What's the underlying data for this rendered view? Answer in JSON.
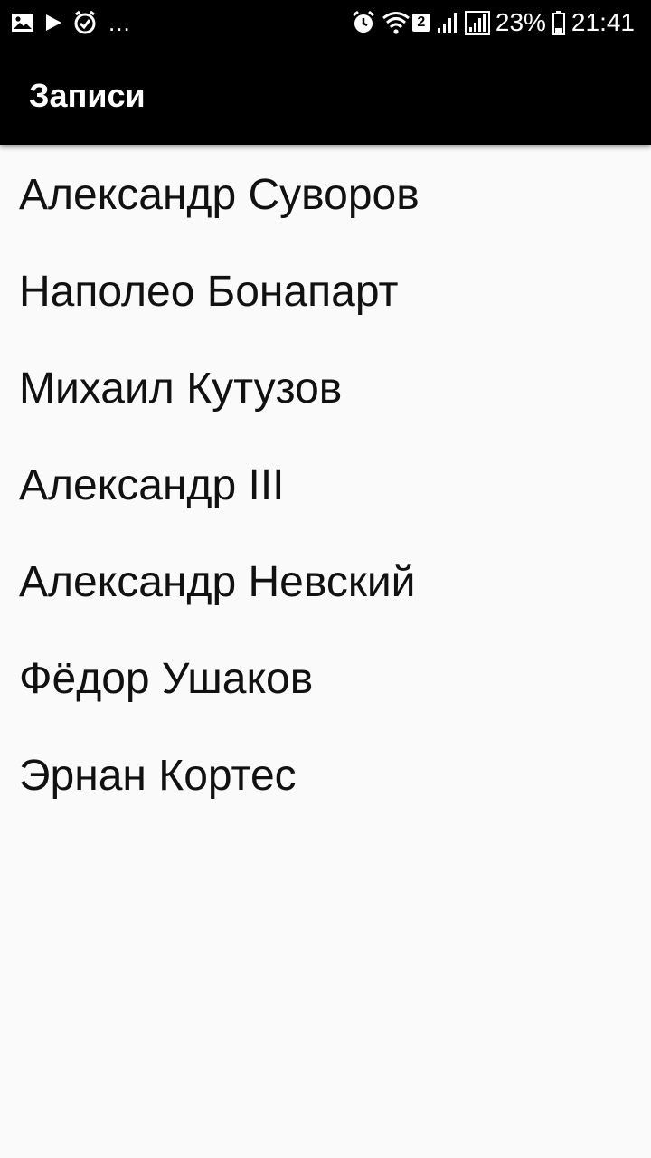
{
  "status_bar": {
    "left_icons": [
      "image-icon",
      "play-icon",
      "clock-check-icon"
    ],
    "more": "...",
    "right_icons": [
      "alarm-icon",
      "wifi-icon",
      "signal-icon",
      "signal-icon",
      "battery-icon"
    ],
    "sim_badge": "2",
    "battery": "23%",
    "time": "21:41"
  },
  "app_bar": {
    "title": "Записи"
  },
  "list": {
    "items": [
      "Александр Суворов",
      "Наполео Бонапарт",
      "Михаил Кутузов",
      "Александр III",
      "Александр Невский",
      "Фёдор Ушаков",
      "Эрнан Кортес"
    ]
  },
  "colors": {
    "bar_background": "#000000",
    "page_background": "#fafafa",
    "text": "#111111"
  }
}
